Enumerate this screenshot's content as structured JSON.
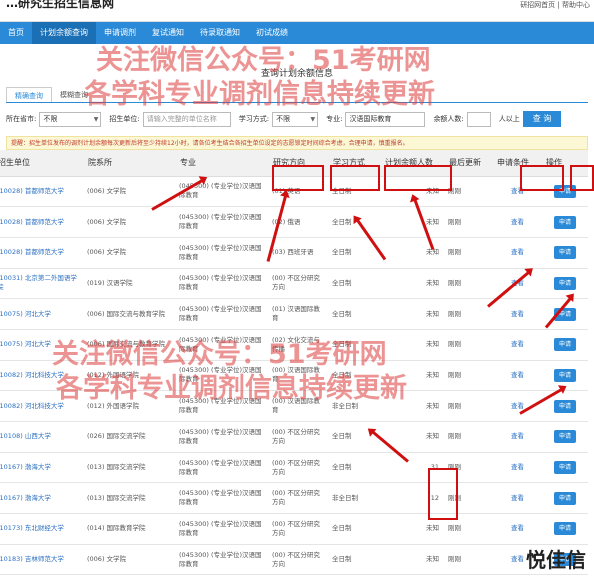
{
  "site": {
    "title": "…研究生招生信息网",
    "links": "研招网首页 | 帮助中心"
  },
  "nav": [
    "首页",
    "计划余额查询",
    "申请调剂",
    "复试通知",
    "待录取通知",
    "初试成绩"
  ],
  "page_title": "查询计划余额信息",
  "tabs": [
    "精确查询",
    "模糊查询"
  ],
  "filters": {
    "province_label": "所在省市:",
    "province_value": "不限",
    "unit_label": "招生单位:",
    "unit_placeholder": "请输入完整的单位名称",
    "mode_label": "学习方式:",
    "mode_value": "不限",
    "major_label": "专业:",
    "major_value": "汉语国际教育",
    "count_label": "余额人数:",
    "count_suffix": "人以上",
    "search_label": "查 询"
  },
  "notice": "提醒：招生单位发布的调剂计划余额每次更新后将至少持续12小时，请各位考生结合各招生单位设定的志愿锁定时间综合考虑，合理申请，慎重报名。",
  "table": {
    "headers": [
      "招生单位",
      "院系所",
      "专业",
      "研究方向",
      "学习方式",
      "计划余额人数",
      "最后更新",
      "申请条件",
      "操作"
    ],
    "rows": [
      [
        "(10028) 首都师范大学",
        "(006) 文学院",
        "(045300) (专业学位)汉语国际教育",
        "(01) 英语",
        "全日制",
        "未知",
        "刚刚",
        "查看",
        "申请"
      ],
      [
        "(10028) 首都师范大学",
        "(006) 文学院",
        "(045300) (专业学位)汉语国际教育",
        "(02) 俄语",
        "全日制",
        "未知",
        "刚刚",
        "查看",
        "申请"
      ],
      [
        "(10028) 首都师范大学",
        "(006) 文学院",
        "(045300) (专业学位)汉语国际教育",
        "(03) 西班牙语",
        "全日制",
        "未知",
        "刚刚",
        "查看",
        "申请"
      ],
      [
        "(10031) 北京第二外国语学院",
        "(019) 汉语学院",
        "(045300) (专业学位)汉语国际教育",
        "(00) 不区分研究方向",
        "全日制",
        "未知",
        "刚刚",
        "查看",
        "申请"
      ],
      [
        "(10075) 河北大学",
        "(006) 国际交流与教育学院",
        "(045300) (专业学位)汉语国际教育",
        "(01) 汉语国际教育",
        "全日制",
        "未知",
        "刚刚",
        "查看",
        "申请"
      ],
      [
        "(10075) 河北大学",
        "(006) 国际交流与教育学院",
        "(045300) (专业学位)汉语国际教育",
        "(02) 文化交流与传播",
        "全日制",
        "未知",
        "刚刚",
        "查看",
        "申请"
      ],
      [
        "(10082) 河北科技大学",
        "(012) 外国语学院",
        "(045300) (专业学位)汉语国际教育",
        "(00) 汉语国际教育",
        "全日制",
        "未知",
        "刚刚",
        "查看",
        "申请"
      ],
      [
        "(10082) 河北科技大学",
        "(012) 外国语学院",
        "(045300) (专业学位)汉语国际教育",
        "(00) 汉语国际教育",
        "非全日制",
        "未知",
        "刚刚",
        "查看",
        "申请"
      ],
      [
        "(10108) 山西大学",
        "(026) 国际交流学院",
        "(045300) (专业学位)汉语国际教育",
        "(00) 不区分研究方向",
        "全日制",
        "未知",
        "刚刚",
        "查看",
        "申请"
      ],
      [
        "(10167) 渤海大学",
        "(013) 国际交流学院",
        "(045300) (专业学位)汉语国际教育",
        "(00) 不区分研究方向",
        "全日制",
        "31",
        "刚刚",
        "查看",
        "申请"
      ],
      [
        "(10167) 渤海大学",
        "(013) 国际交流学院",
        "(045300) (专业学位)汉语国际教育",
        "(00) 不区分研究方向",
        "非全日制",
        "12",
        "刚刚",
        "查看",
        "申请"
      ],
      [
        "(10173) 东北财经大学",
        "(014) 国际教育学院",
        "(045300) (专业学位)汉语国际教育",
        "(00) 不区分研究方向",
        "全日制",
        "未知",
        "刚刚",
        "查看",
        "申请"
      ],
      [
        "(10183) 吉林师范大学",
        "(006) 文学院",
        "(045300) (专业学位)汉语国际教育",
        "(00) 不区分研究方向",
        "全日制",
        "未知",
        "刚刚",
        "查看",
        "申请"
      ]
    ]
  },
  "watermark": {
    "line1": "关注微信公众号：51考研网",
    "line2": "各学科专业调剂信息持续更新"
  },
  "corner_mark": "悦佳信",
  "colors": {
    "nav": "#2a8ad7",
    "annotation": "#d01010",
    "watermark": "#dc3c3c"
  }
}
